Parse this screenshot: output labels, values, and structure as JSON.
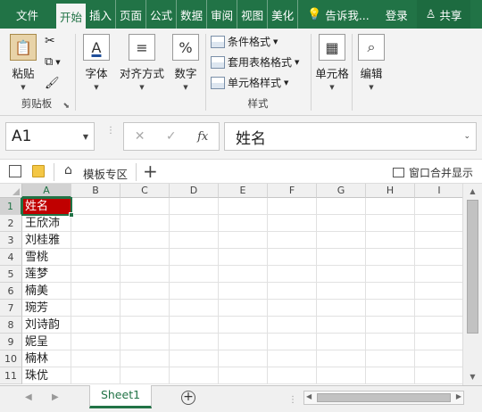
{
  "ribbon_tabs": [
    "文件",
    "开始",
    "插入",
    "页面",
    "公式",
    "数据",
    "审阅",
    "视图",
    "美化"
  ],
  "active_tab": "开始",
  "tell_me": "告诉我...",
  "login": "登录",
  "share": "共享",
  "ribbon": {
    "paste": "粘贴",
    "clipboard_group": "剪贴板",
    "font": "字体",
    "alignment": "对齐方式",
    "number": "数字",
    "conditional_format": "条件格式",
    "table_format": "套用表格格式",
    "cell_style": "单元格样式",
    "style_group": "样式",
    "cells": "单元格",
    "editing": "编辑"
  },
  "formula_bar": {
    "name_box": "A1",
    "fx": "fx",
    "content": "姓名"
  },
  "workbar": {
    "template_zone": "模板专区",
    "merge_window": "窗口合并显示"
  },
  "columns": [
    "A",
    "B",
    "C",
    "D",
    "E",
    "F",
    "G",
    "H",
    "I"
  ],
  "rows": [
    {
      "num": "1",
      "a": "姓名"
    },
    {
      "num": "2",
      "a": "王欣沛"
    },
    {
      "num": "3",
      "a": "刘桂雅"
    },
    {
      "num": "4",
      "a": "雪桃"
    },
    {
      "num": "5",
      "a": "莲梦"
    },
    {
      "num": "6",
      "a": "楠美"
    },
    {
      "num": "7",
      "a": "琬芳"
    },
    {
      "num": "8",
      "a": "刘诗韵"
    },
    {
      "num": "9",
      "a": "妮呈"
    },
    {
      "num": "10",
      "a": "楠林"
    },
    {
      "num": "11",
      "a": "珠优"
    }
  ],
  "sheet_tab": "Sheet1",
  "colors": {
    "excel_green": "#217346",
    "header_fill": "#c00000"
  }
}
